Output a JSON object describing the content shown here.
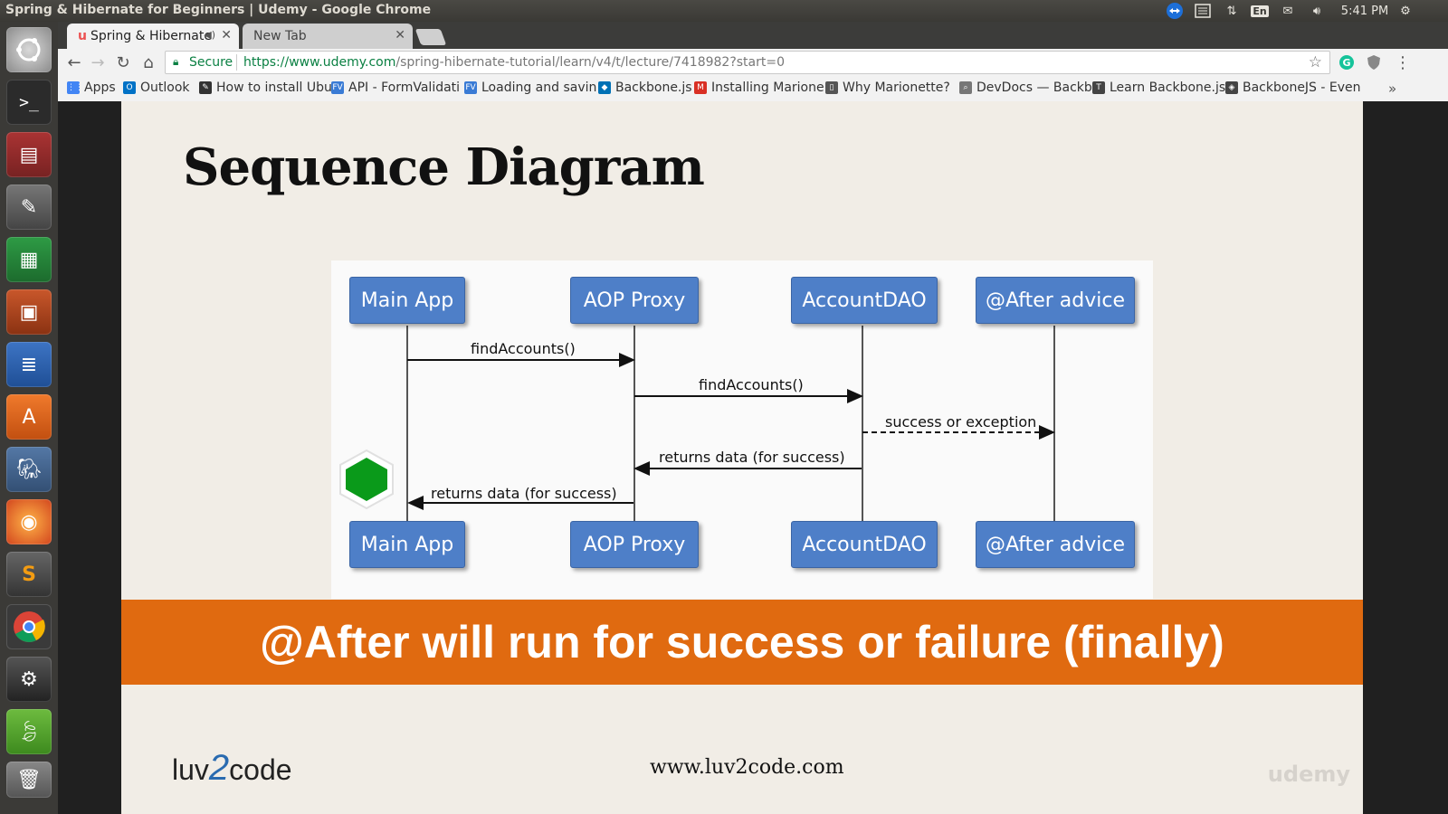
{
  "window": {
    "title": "Spring & Hibernate for Beginners | Udemy - Google Chrome"
  },
  "system": {
    "keyboard": "En",
    "time": "5:41 PM"
  },
  "tabs": [
    {
      "label": "Spring & Hibernatе"
    },
    {
      "label": "New Tab"
    }
  ],
  "omnibox": {
    "secure_label": "Secure",
    "scheme": "https://",
    "host": "www.udemy.com",
    "path": "/spring-hibernate-tutorial/learn/v4/t/lecture/7418982?start=0"
  },
  "bookmarks": [
    {
      "label": "Apps",
      "icon": "apps-grid-icon",
      "color": "#4285f4"
    },
    {
      "label": "Outlook",
      "icon": "outlook-icon",
      "color": "#0072c6"
    },
    {
      "label": "How to install Ubu",
      "icon": "blog-icon",
      "color": "#333333"
    },
    {
      "label": "API - FormValidati",
      "icon": "fv-icon",
      "color": "#3a7bd5"
    },
    {
      "label": "Loading and savin",
      "icon": "fv-icon",
      "color": "#3a7bd5"
    },
    {
      "label": "Backbone.js",
      "icon": "backbone-icon",
      "color": "#0071b5"
    },
    {
      "label": "Installing Marione",
      "icon": "gmail-icon",
      "color": "#d93025"
    },
    {
      "label": "Why Marionette?",
      "icon": "book-icon",
      "color": "#555555"
    },
    {
      "label": "DevDocs — Backb",
      "icon": "devdocs-icon",
      "color": "#777777"
    },
    {
      "label": "Learn Backbone.js",
      "icon": "text-icon",
      "color": "#444444"
    },
    {
      "label": "BackboneJS - Even",
      "icon": "diamond-icon",
      "color": "#444444"
    }
  ],
  "slide": {
    "title": "Sequence Diagram",
    "diagram": {
      "participants": [
        "Main App",
        "AOP Proxy",
        "AccountDAO",
        "@After advice"
      ],
      "messages": [
        {
          "label": "findAccounts()",
          "from": "Main App",
          "to": "AOP Proxy",
          "style": "solid"
        },
        {
          "label": "findAccounts()",
          "from": "AOP Proxy",
          "to": "AccountDAO",
          "style": "solid"
        },
        {
          "label": "success or exception",
          "from": "AccountDAO",
          "to": "@After advice",
          "style": "dashed"
        },
        {
          "label": "returns data (for success)",
          "from": "AccountDAO",
          "to": "AOP Proxy",
          "style": "solid"
        },
        {
          "label": "returns data (for success)",
          "from": "AOP Proxy",
          "to": "Main App",
          "style": "solid"
        }
      ],
      "box_color": "#4e7fc8",
      "marker_color": "#0a9a1a"
    },
    "banner": "@After will run for success or failure (finally)",
    "banner_color": "#e06a10",
    "logo": {
      "part1": "luv",
      "part2": "2",
      "part3": "code"
    },
    "website": "www.luv2code.com",
    "watermark": "udemy"
  }
}
